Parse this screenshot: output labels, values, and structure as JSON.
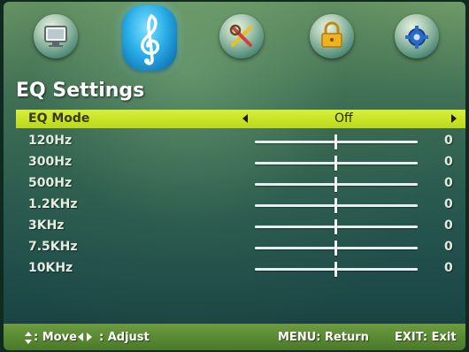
{
  "header": {
    "menu_icons": [
      {
        "name": "picture-icon",
        "active": false
      },
      {
        "name": "sound-icon",
        "active": true
      },
      {
        "name": "tools-icon",
        "active": false
      },
      {
        "name": "lock-icon",
        "active": false
      },
      {
        "name": "setup-icon",
        "active": false
      }
    ]
  },
  "page": {
    "title": "EQ Settings"
  },
  "eq_mode": {
    "label": "EQ Mode",
    "value": "Off"
  },
  "bands": [
    {
      "label": "120Hz",
      "value": "0"
    },
    {
      "label": "300Hz",
      "value": "0"
    },
    {
      "label": "500Hz",
      "value": "0"
    },
    {
      "label": "1.2KHz",
      "value": "0"
    },
    {
      "label": "3KHz",
      "value": "0"
    },
    {
      "label": "7.5KHz",
      "value": "0"
    },
    {
      "label": "10KHz",
      "value": "0"
    }
  ],
  "footer": {
    "move": ": Move",
    "adjust": ": Adjust",
    "menu": "MENU: Return",
    "exit": "EXIT: Exit"
  },
  "colors": {
    "highlight": "#c8e02a",
    "footer": "#5a8a33",
    "active_icon": "#2aaee8"
  }
}
